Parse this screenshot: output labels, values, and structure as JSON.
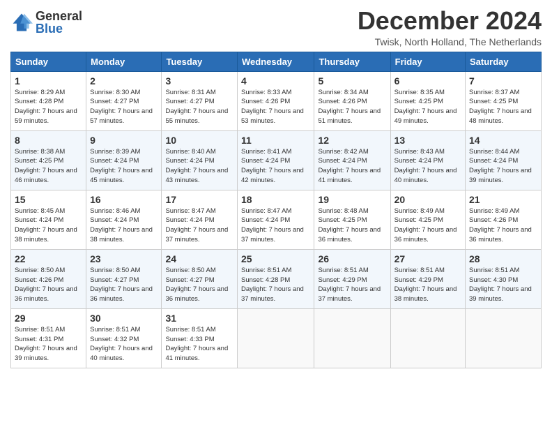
{
  "header": {
    "logo": {
      "general": "General",
      "blue": "Blue"
    },
    "title": "December 2024",
    "location": "Twisk, North Holland, The Netherlands"
  },
  "weekdays": [
    "Sunday",
    "Monday",
    "Tuesday",
    "Wednesday",
    "Thursday",
    "Friday",
    "Saturday"
  ],
  "weeks": [
    [
      {
        "day": "1",
        "sunrise": "Sunrise: 8:29 AM",
        "sunset": "Sunset: 4:28 PM",
        "daylight": "Daylight: 7 hours and 59 minutes."
      },
      {
        "day": "2",
        "sunrise": "Sunrise: 8:30 AM",
        "sunset": "Sunset: 4:27 PM",
        "daylight": "Daylight: 7 hours and 57 minutes."
      },
      {
        "day": "3",
        "sunrise": "Sunrise: 8:31 AM",
        "sunset": "Sunset: 4:27 PM",
        "daylight": "Daylight: 7 hours and 55 minutes."
      },
      {
        "day": "4",
        "sunrise": "Sunrise: 8:33 AM",
        "sunset": "Sunset: 4:26 PM",
        "daylight": "Daylight: 7 hours and 53 minutes."
      },
      {
        "day": "5",
        "sunrise": "Sunrise: 8:34 AM",
        "sunset": "Sunset: 4:26 PM",
        "daylight": "Daylight: 7 hours and 51 minutes."
      },
      {
        "day": "6",
        "sunrise": "Sunrise: 8:35 AM",
        "sunset": "Sunset: 4:25 PM",
        "daylight": "Daylight: 7 hours and 49 minutes."
      },
      {
        "day": "7",
        "sunrise": "Sunrise: 8:37 AM",
        "sunset": "Sunset: 4:25 PM",
        "daylight": "Daylight: 7 hours and 48 minutes."
      }
    ],
    [
      {
        "day": "8",
        "sunrise": "Sunrise: 8:38 AM",
        "sunset": "Sunset: 4:25 PM",
        "daylight": "Daylight: 7 hours and 46 minutes."
      },
      {
        "day": "9",
        "sunrise": "Sunrise: 8:39 AM",
        "sunset": "Sunset: 4:24 PM",
        "daylight": "Daylight: 7 hours and 45 minutes."
      },
      {
        "day": "10",
        "sunrise": "Sunrise: 8:40 AM",
        "sunset": "Sunset: 4:24 PM",
        "daylight": "Daylight: 7 hours and 43 minutes."
      },
      {
        "day": "11",
        "sunrise": "Sunrise: 8:41 AM",
        "sunset": "Sunset: 4:24 PM",
        "daylight": "Daylight: 7 hours and 42 minutes."
      },
      {
        "day": "12",
        "sunrise": "Sunrise: 8:42 AM",
        "sunset": "Sunset: 4:24 PM",
        "daylight": "Daylight: 7 hours and 41 minutes."
      },
      {
        "day": "13",
        "sunrise": "Sunrise: 8:43 AM",
        "sunset": "Sunset: 4:24 PM",
        "daylight": "Daylight: 7 hours and 40 minutes."
      },
      {
        "day": "14",
        "sunrise": "Sunrise: 8:44 AM",
        "sunset": "Sunset: 4:24 PM",
        "daylight": "Daylight: 7 hours and 39 minutes."
      }
    ],
    [
      {
        "day": "15",
        "sunrise": "Sunrise: 8:45 AM",
        "sunset": "Sunset: 4:24 PM",
        "daylight": "Daylight: 7 hours and 38 minutes."
      },
      {
        "day": "16",
        "sunrise": "Sunrise: 8:46 AM",
        "sunset": "Sunset: 4:24 PM",
        "daylight": "Daylight: 7 hours and 38 minutes."
      },
      {
        "day": "17",
        "sunrise": "Sunrise: 8:47 AM",
        "sunset": "Sunset: 4:24 PM",
        "daylight": "Daylight: 7 hours and 37 minutes."
      },
      {
        "day": "18",
        "sunrise": "Sunrise: 8:47 AM",
        "sunset": "Sunset: 4:24 PM",
        "daylight": "Daylight: 7 hours and 37 minutes."
      },
      {
        "day": "19",
        "sunrise": "Sunrise: 8:48 AM",
        "sunset": "Sunset: 4:25 PM",
        "daylight": "Daylight: 7 hours and 36 minutes."
      },
      {
        "day": "20",
        "sunrise": "Sunrise: 8:49 AM",
        "sunset": "Sunset: 4:25 PM",
        "daylight": "Daylight: 7 hours and 36 minutes."
      },
      {
        "day": "21",
        "sunrise": "Sunrise: 8:49 AM",
        "sunset": "Sunset: 4:26 PM",
        "daylight": "Daylight: 7 hours and 36 minutes."
      }
    ],
    [
      {
        "day": "22",
        "sunrise": "Sunrise: 8:50 AM",
        "sunset": "Sunset: 4:26 PM",
        "daylight": "Daylight: 7 hours and 36 minutes."
      },
      {
        "day": "23",
        "sunrise": "Sunrise: 8:50 AM",
        "sunset": "Sunset: 4:27 PM",
        "daylight": "Daylight: 7 hours and 36 minutes."
      },
      {
        "day": "24",
        "sunrise": "Sunrise: 8:50 AM",
        "sunset": "Sunset: 4:27 PM",
        "daylight": "Daylight: 7 hours and 36 minutes."
      },
      {
        "day": "25",
        "sunrise": "Sunrise: 8:51 AM",
        "sunset": "Sunset: 4:28 PM",
        "daylight": "Daylight: 7 hours and 37 minutes."
      },
      {
        "day": "26",
        "sunrise": "Sunrise: 8:51 AM",
        "sunset": "Sunset: 4:29 PM",
        "daylight": "Daylight: 7 hours and 37 minutes."
      },
      {
        "day": "27",
        "sunrise": "Sunrise: 8:51 AM",
        "sunset": "Sunset: 4:29 PM",
        "daylight": "Daylight: 7 hours and 38 minutes."
      },
      {
        "day": "28",
        "sunrise": "Sunrise: 8:51 AM",
        "sunset": "Sunset: 4:30 PM",
        "daylight": "Daylight: 7 hours and 39 minutes."
      }
    ],
    [
      {
        "day": "29",
        "sunrise": "Sunrise: 8:51 AM",
        "sunset": "Sunset: 4:31 PM",
        "daylight": "Daylight: 7 hours and 39 minutes."
      },
      {
        "day": "30",
        "sunrise": "Sunrise: 8:51 AM",
        "sunset": "Sunset: 4:32 PM",
        "daylight": "Daylight: 7 hours and 40 minutes."
      },
      {
        "day": "31",
        "sunrise": "Sunrise: 8:51 AM",
        "sunset": "Sunset: 4:33 PM",
        "daylight": "Daylight: 7 hours and 41 minutes."
      },
      null,
      null,
      null,
      null
    ]
  ]
}
